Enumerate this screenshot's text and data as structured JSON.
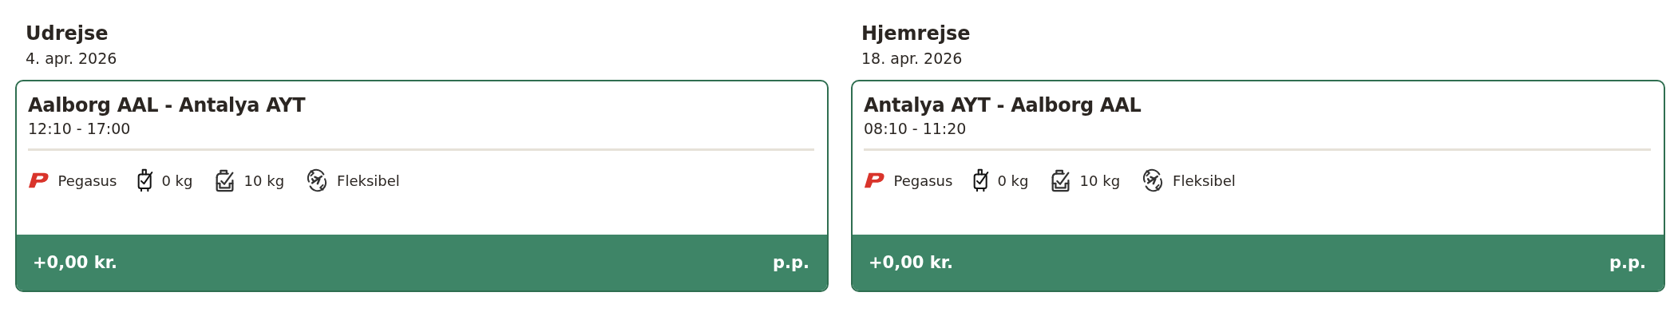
{
  "legs": [
    {
      "heading": "Udrejse",
      "date": "4. apr. 2026",
      "route": "Aalborg AAL - Antalya AYT",
      "time": "12:10 - 17:00",
      "features": [
        {
          "kind": "airline",
          "label": "Pegasus"
        },
        {
          "kind": "cabin-bag",
          "label": "0 kg"
        },
        {
          "kind": "checked-bag",
          "label": "10 kg"
        },
        {
          "kind": "flexible",
          "label": "Fleksibel"
        }
      ],
      "price": "+0,00 kr.",
      "price_unit": "p.p."
    },
    {
      "heading": "Hjemrejse",
      "date": "18. apr. 2026",
      "route": "Antalya AYT - Aalborg AAL",
      "time": "08:10 - 11:20",
      "features": [
        {
          "kind": "airline",
          "label": "Pegasus"
        },
        {
          "kind": "cabin-bag",
          "label": "0 kg"
        },
        {
          "kind": "checked-bag",
          "label": "10 kg"
        },
        {
          "kind": "flexible",
          "label": "Fleksibel"
        }
      ],
      "price": "+0,00 kr.",
      "price_unit": "p.p."
    }
  ]
}
